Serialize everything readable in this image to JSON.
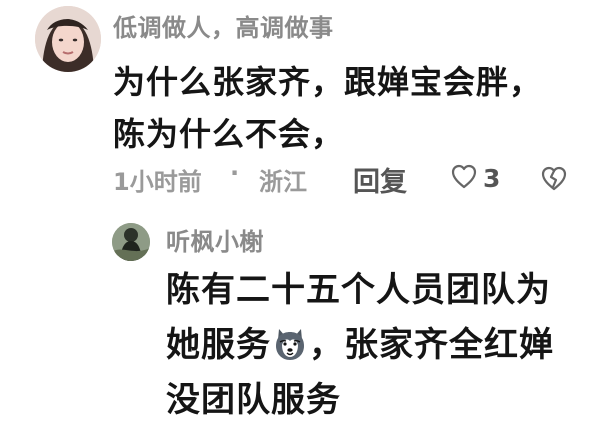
{
  "comment": {
    "username": "低调做人，高调做事",
    "text_line1": "为什么张家齐，跟婵宝会胖，",
    "text_line2": "陈为什么不会，",
    "time": "1小时前",
    "separator": "·",
    "location": "浙江",
    "reply_label": "回复",
    "like_count": "3"
  },
  "reply": {
    "username": "听枫小榭",
    "text_line1": "陈有二十五个人员团队为",
    "text_line2_before_emoji": "她服务",
    "text_line2_after_emoji": "，张家齐全红婵",
    "text_line3": "没团队服务",
    "emoji_icon": "husky-dog-emoji-icon"
  },
  "colors": {
    "meta_gray": "#9a9a9a",
    "username_gray": "#8a8a8a",
    "text_dark": "#151515"
  }
}
